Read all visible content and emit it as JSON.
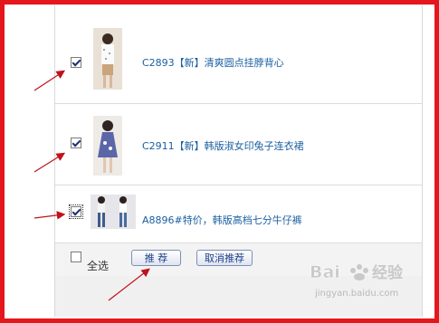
{
  "products": [
    {
      "title": "C2893【新】清爽圆点挂脖背心",
      "checked": true,
      "thumb_icon": "product-photo-top"
    },
    {
      "title": "C2911【新】韩版淑女印兔子连衣裙",
      "checked": true,
      "thumb_icon": "product-photo-dress"
    },
    {
      "title": "A8896#特价，韩版高档七分牛仔裤",
      "checked": true,
      "thumb_icon": "product-photo-jeans"
    }
  ],
  "footer": {
    "select_all_label": "全选",
    "select_all_checked": false,
    "recommend_label": "推 荐",
    "cancel_recommend_label": "取消推荐"
  },
  "watermark": {
    "brand": "Bai",
    "brand_suffix": "经验",
    "url": "jingyan.baidu.com"
  },
  "colors": {
    "frame": "#e4181c",
    "link": "#1a5fa0",
    "arrow": "#c0121a"
  }
}
